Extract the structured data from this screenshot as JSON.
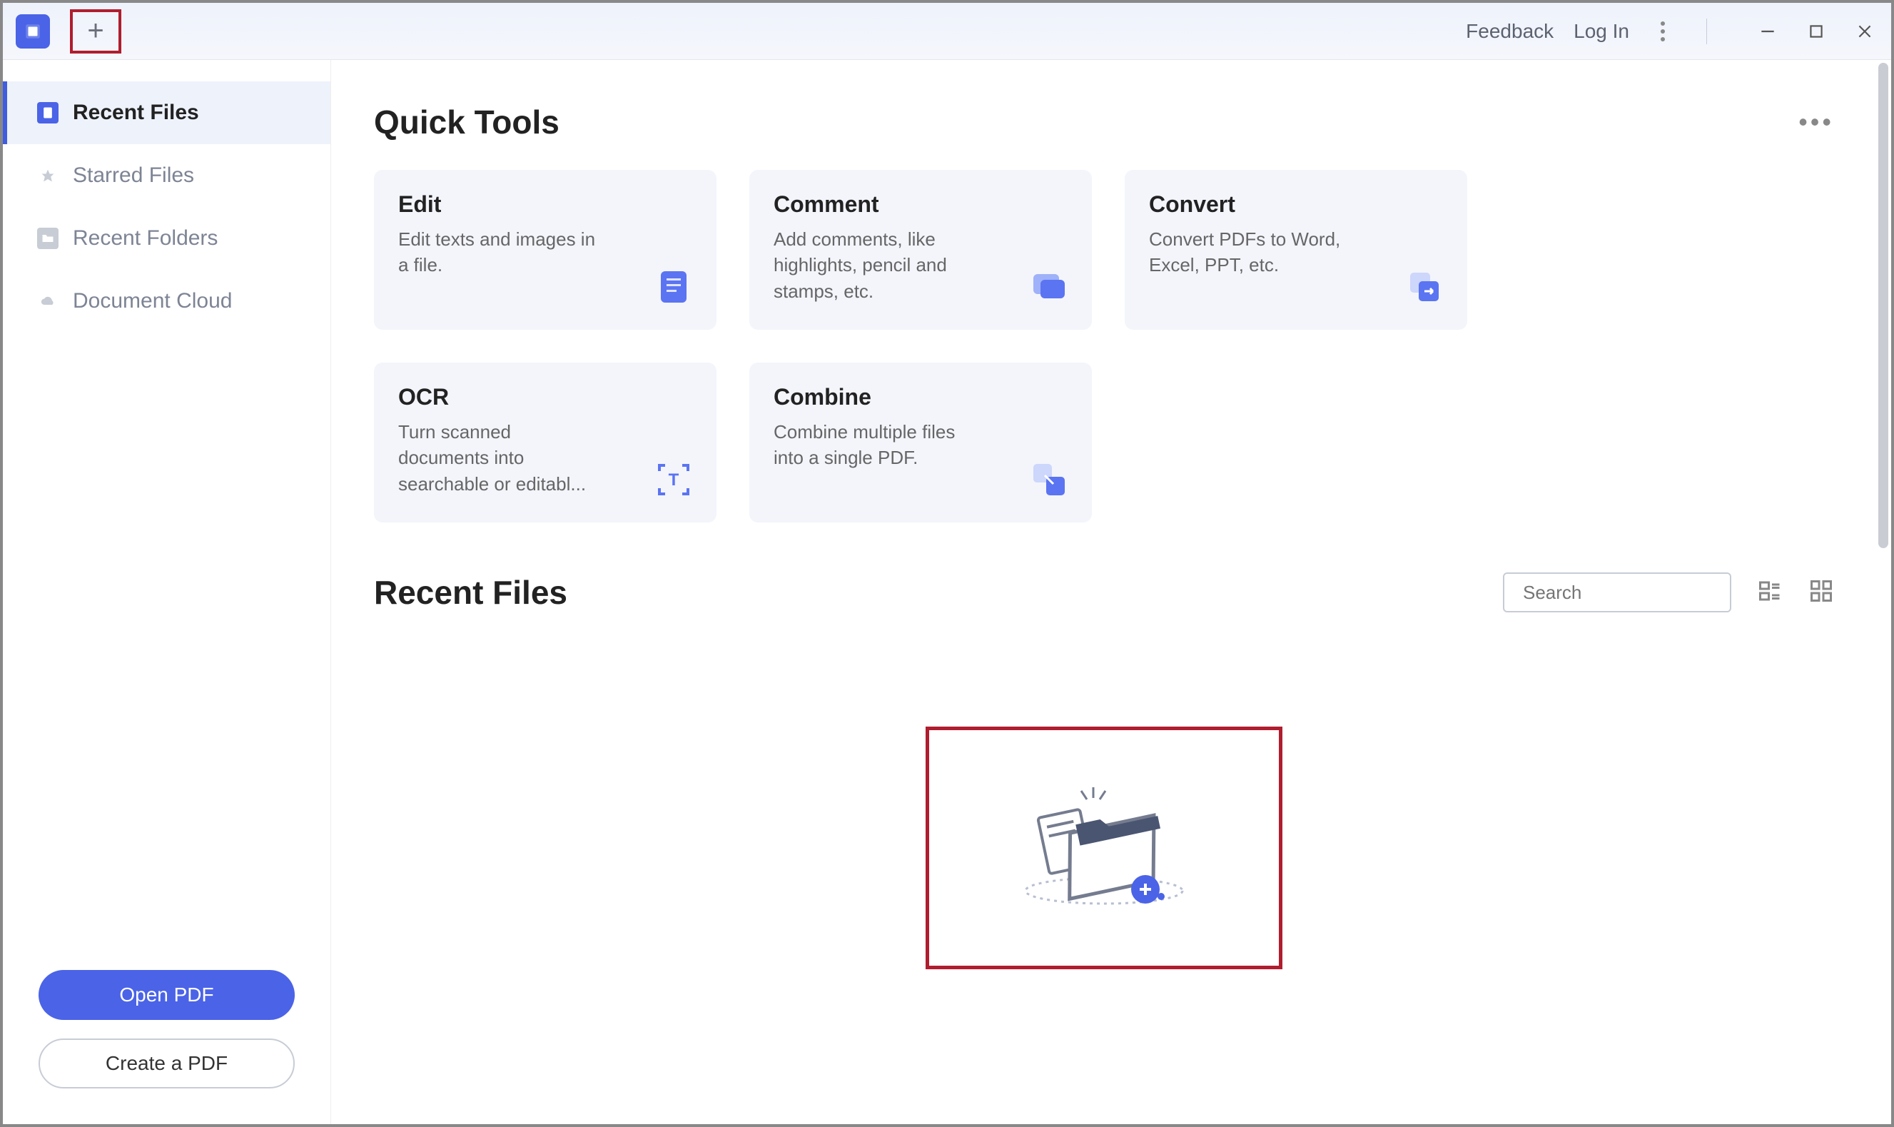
{
  "titlebar": {
    "feedback": "Feedback",
    "login": "Log In"
  },
  "sidebar": {
    "items": [
      {
        "label": "Recent Files"
      },
      {
        "label": "Starred Files"
      },
      {
        "label": "Recent Folders"
      },
      {
        "label": "Document Cloud"
      }
    ],
    "open_pdf": "Open PDF",
    "create_pdf": "Create a PDF"
  },
  "main": {
    "quick_tools_title": "Quick Tools",
    "tools": [
      {
        "title": "Edit",
        "desc": "Edit texts and images in a file."
      },
      {
        "title": "Comment",
        "desc": "Add comments, like highlights, pencil and stamps, etc."
      },
      {
        "title": "Convert",
        "desc": "Convert PDFs to Word, Excel, PPT, etc."
      },
      {
        "title": "OCR",
        "desc": "Turn scanned documents into searchable or editabl..."
      },
      {
        "title": "Combine",
        "desc": "Combine multiple files into a single PDF."
      }
    ],
    "recent_title": "Recent Files",
    "search_placeholder": "Search"
  }
}
